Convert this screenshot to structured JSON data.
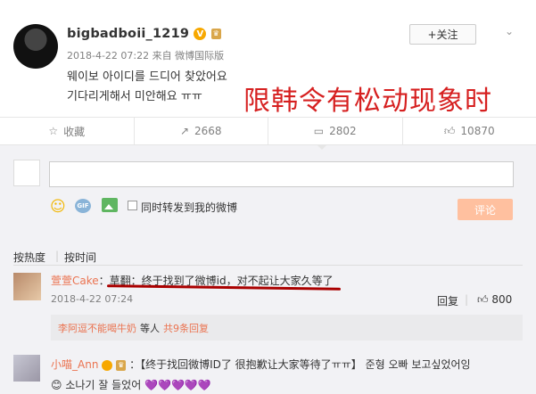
{
  "post": {
    "username": "bigbadboii_1219",
    "verified_icon": "v-badge",
    "meta": "2018-4-22 07:22 来自 微博国际版",
    "line1": "웨이보 아이디를 드디어 찾았어요",
    "line2": "기다리게해서 미안해요 ㅠㅠ",
    "follow_label": "+关注"
  },
  "overlay": {
    "title": "限韩令有松动现象时",
    "color": "#d62020"
  },
  "actions": {
    "favorite_label": "收藏",
    "repost_count": "2668",
    "comment_count": "2802",
    "like_count": "10870"
  },
  "composer": {
    "input_value": "",
    "repost_checkbox_label": "同时转发到我的微博",
    "submit_label": "评论"
  },
  "sort": {
    "hot_label": "按热度",
    "time_label": "按时间"
  },
  "comments": [
    {
      "name": "萱萱Cake",
      "separator": "：",
      "text": "草翻：终于找到了微博id，对不起让大家久等了",
      "time": "2018-4-22 07:24",
      "reply_label": "回复",
      "like_count": "800",
      "reply_box": {
        "name": "李阿逗不能喝牛奶",
        "waiting": "等人",
        "more": "共9条回复"
      }
    },
    {
      "name": "小喵_Ann",
      "text1": "：【终于找回微博ID了 很抱歉让大家等待了ㅠㅠ】 준형 오빠 보고싶었어잉",
      "text2": "소나기 잘 들었어",
      "hearts": "💜💜💜💜💜"
    }
  ],
  "colors": {
    "accent": "#eb7350",
    "verified": "#f7a800",
    "submit": "#ffc09f"
  }
}
